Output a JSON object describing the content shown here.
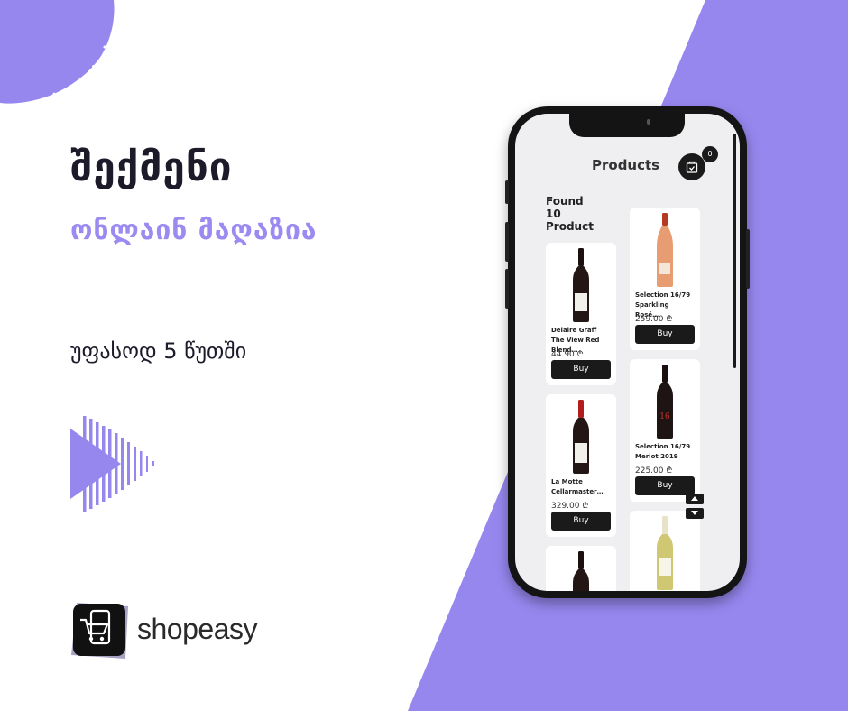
{
  "headline": "შექმენი",
  "subheadline": "ონლაინ მაღაზია",
  "tagline": "უფასოდ 5 წუთში",
  "brand": {
    "name": "shopeasy",
    "logo_icon": "cart-phone-icon"
  },
  "colors": {
    "accent": "#9b8af1",
    "dark": "#1d1b2a",
    "phone": "#141414"
  },
  "phone_app": {
    "title": "Products",
    "cart_count": "0",
    "found_lines": [
      "Found",
      "10",
      "Product"
    ],
    "buy_label": "Buy",
    "products": [
      {
        "name": "Delaire Graff The View Red Blend…",
        "price": "44.90 ₾",
        "bottle": "red"
      },
      {
        "name": "Selection 16/79 Sparkling Rosé…",
        "price": "259.00 ₾",
        "bottle": "rose"
      },
      {
        "name": "La Motte Cellarmaster…",
        "price": "329.00 ₾",
        "bottle": "red"
      },
      {
        "name": "Selection 16/79 Meriot 2019",
        "price": "225.00 ₾",
        "bottle": "red"
      },
      {
        "name": "",
        "price": "",
        "bottle": "red"
      },
      {
        "name": "",
        "price": "",
        "bottle": "white"
      }
    ]
  }
}
